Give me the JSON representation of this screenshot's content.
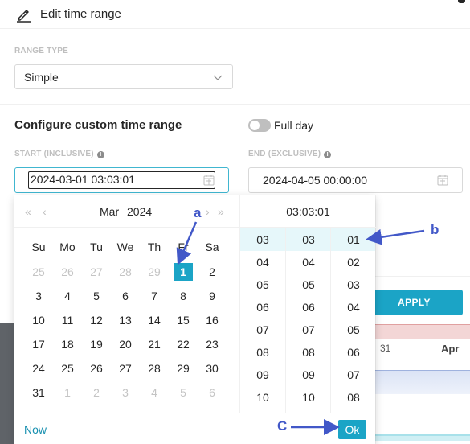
{
  "header": {
    "title": "Edit time range",
    "icon": "edit-icon"
  },
  "range_type": {
    "label": "RANGE TYPE",
    "value": "Simple"
  },
  "custom": {
    "title": "Configure custom time range",
    "full_day_label": "Full day",
    "full_day_on": false
  },
  "start": {
    "label": "START (INCLUSIVE)",
    "value": "2024-03-01 03:03:01"
  },
  "end": {
    "label": "END (EXCLUSIVE)",
    "value": "2024-04-05 00:00:00"
  },
  "apply_label": "APPLY",
  "background_ticks": {
    "t1": "31",
    "t2": "Apr"
  },
  "calendar": {
    "nav_prev_year": "«",
    "nav_prev_month": "‹",
    "nav_next_month": "›",
    "nav_next_year": "»",
    "month": "Mar",
    "year": "2024",
    "weekdays": [
      "Su",
      "Mo",
      "Tu",
      "We",
      "Th",
      "Fr",
      "Sa"
    ],
    "weeks": [
      [
        "25",
        "26",
        "27",
        "28",
        "29",
        "1",
        "2"
      ],
      [
        "3",
        "4",
        "5",
        "6",
        "7",
        "8",
        "9"
      ],
      [
        "10",
        "11",
        "12",
        "13",
        "14",
        "15",
        "16"
      ],
      [
        "17",
        "18",
        "19",
        "20",
        "21",
        "22",
        "23"
      ],
      [
        "24",
        "25",
        "26",
        "27",
        "28",
        "29",
        "30"
      ],
      [
        "31",
        "1",
        "2",
        "3",
        "4",
        "5",
        "6"
      ]
    ],
    "selected_day": "1"
  },
  "time": {
    "header": "03:03:01",
    "hours": [
      "03",
      "04",
      "05",
      "06",
      "07",
      "08",
      "09",
      "10"
    ],
    "minutes": [
      "03",
      "04",
      "05",
      "06",
      "07",
      "08",
      "09",
      "10"
    ],
    "seconds": [
      "01",
      "02",
      "03",
      "04",
      "05",
      "06",
      "07",
      "08"
    ]
  },
  "footer": {
    "now_label": "Now",
    "ok_label": "Ok"
  },
  "annotations": {
    "a": "a",
    "b": "b",
    "c": "C"
  },
  "colors": {
    "accent": "#1ba4c6",
    "annotation": "#4258c8",
    "selected_time_bg": "#e6f7fa"
  }
}
